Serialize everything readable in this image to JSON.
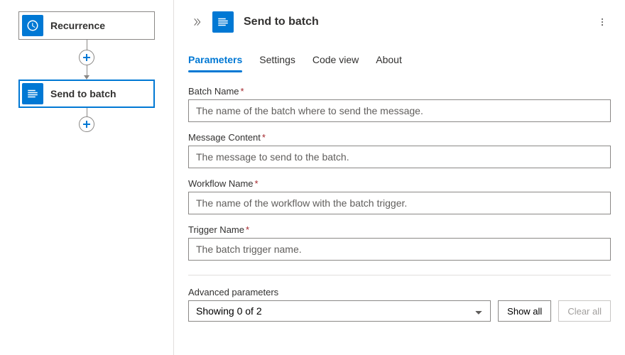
{
  "canvas": {
    "nodes": [
      {
        "label": "Recurrence",
        "icon": "clock",
        "selected": false
      },
      {
        "label": "Send to batch",
        "icon": "batch",
        "selected": true
      }
    ]
  },
  "panel": {
    "title": "Send to batch",
    "tabs": [
      {
        "label": "Parameters",
        "active": true
      },
      {
        "label": "Settings",
        "active": false
      },
      {
        "label": "Code view",
        "active": false
      },
      {
        "label": "About",
        "active": false
      }
    ],
    "fields": {
      "batchName": {
        "label": "Batch Name",
        "required": true,
        "placeholder": "The name of the batch where to send the message."
      },
      "messageContent": {
        "label": "Message Content",
        "required": true,
        "placeholder": "The message to send to the batch."
      },
      "workflowName": {
        "label": "Workflow Name",
        "required": true,
        "placeholder": "The name of the workflow with the batch trigger."
      },
      "triggerName": {
        "label": "Trigger Name",
        "required": true,
        "placeholder": "The batch trigger name."
      }
    },
    "advanced": {
      "label": "Advanced parameters",
      "selectText": "Showing 0 of 2",
      "showAll": "Show all",
      "clearAll": "Clear all"
    }
  }
}
